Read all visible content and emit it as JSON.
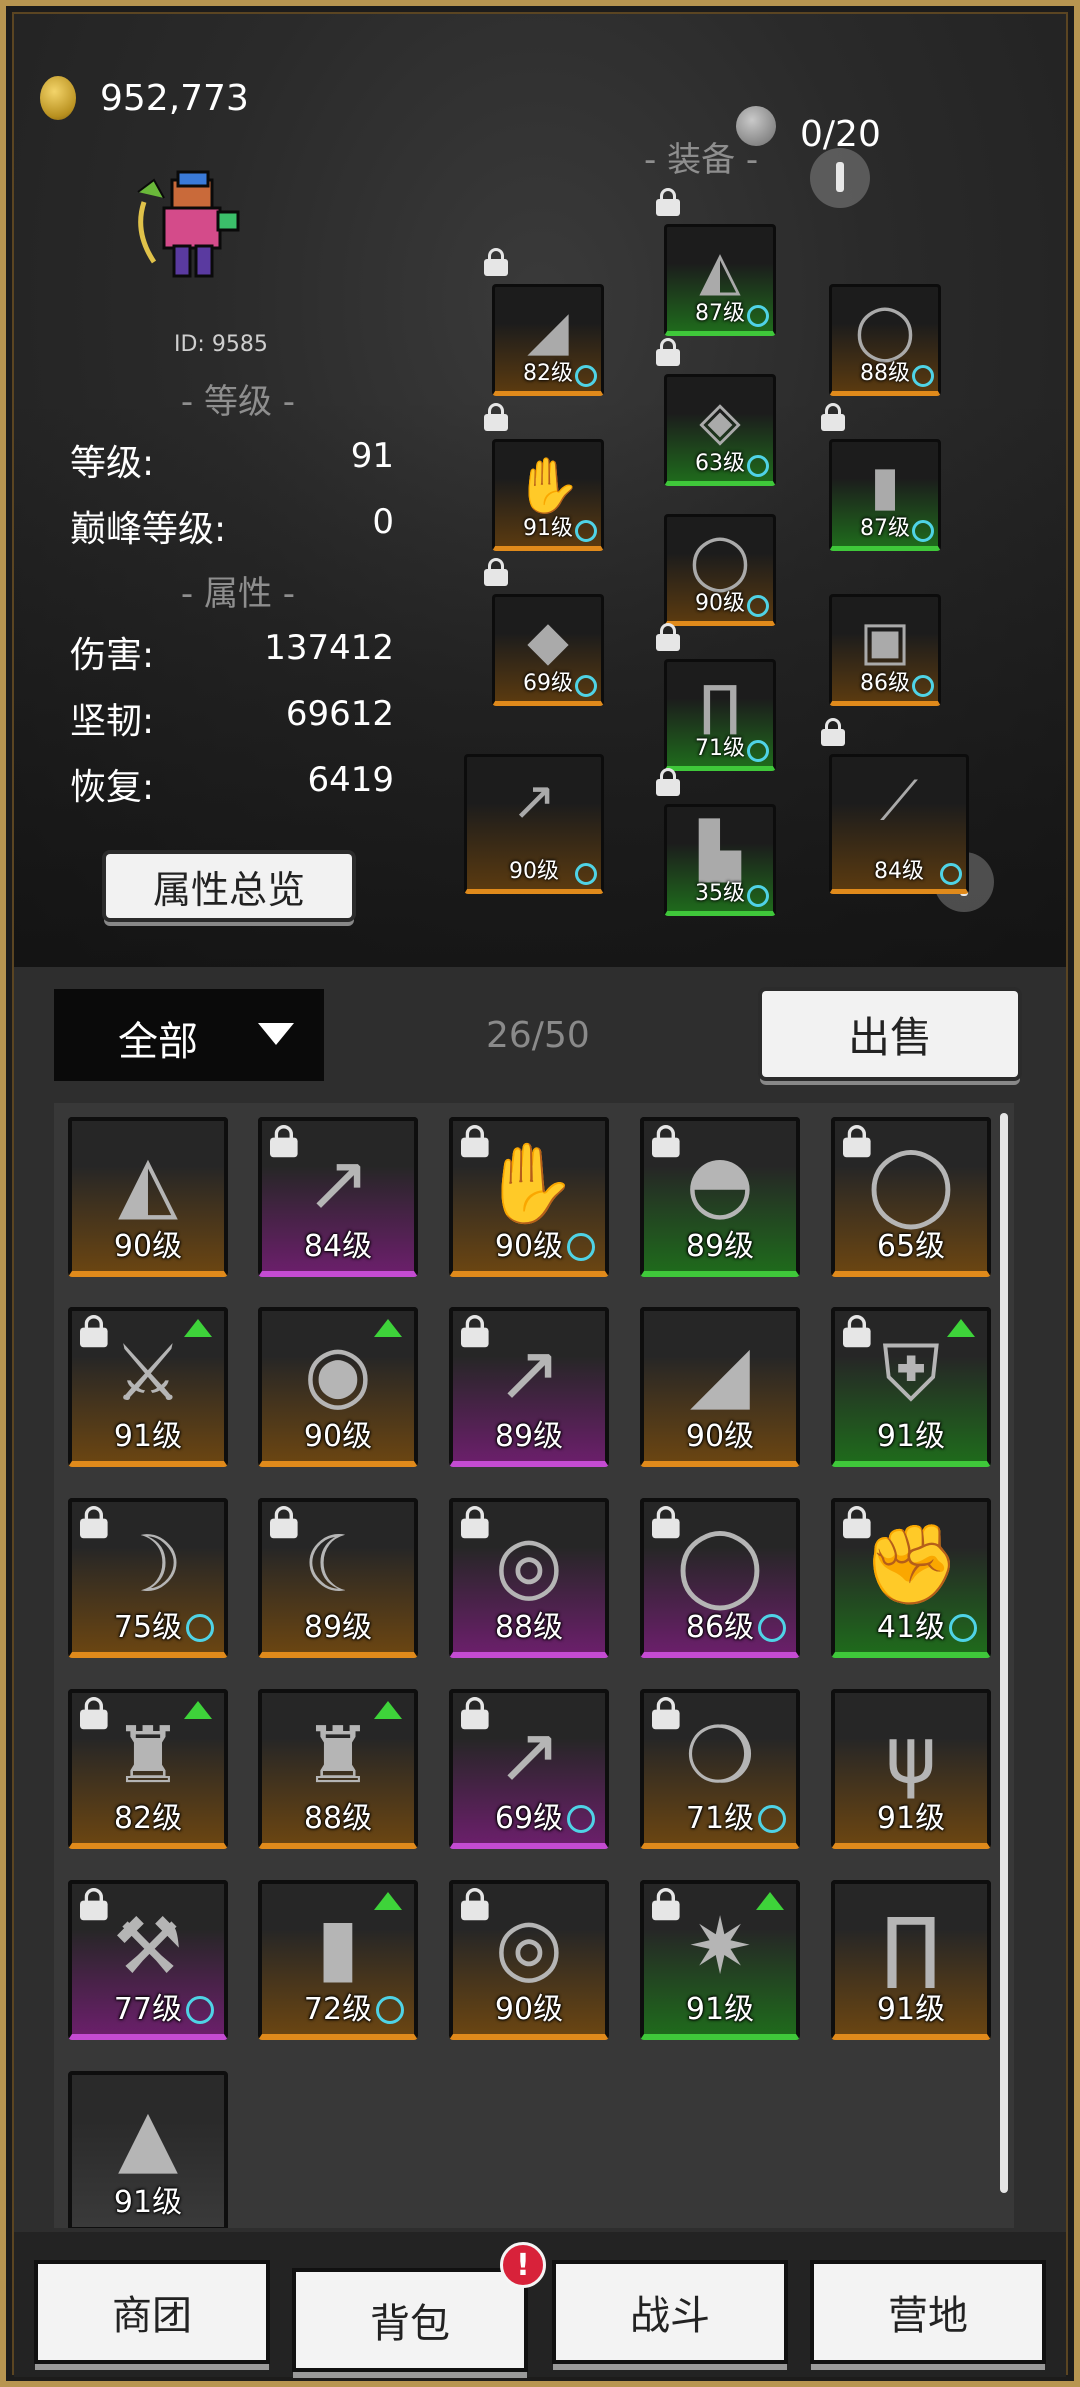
{
  "header": {
    "gold": "952,773",
    "equip_title": "- 装备 -",
    "equip_count": "0/20"
  },
  "profile": {
    "id_text": "ID: 9585"
  },
  "sections": {
    "level_title": "- 等级 -",
    "attr_title": "- 属性 -"
  },
  "stats": {
    "level_label": "等级:",
    "level_value": "91",
    "peak_label": "巅峰等级:",
    "peak_value": "0",
    "damage_label": "伤害:",
    "damage_value": "137412",
    "toughness_label": "坚韧:",
    "toughness_value": "69612",
    "recovery_label": "恢复:",
    "recovery_value": "6419"
  },
  "overview_button": "属性总览",
  "equipment": [
    {
      "level": "82级",
      "rarity": "orange",
      "icon": "cape-icon",
      "locked": true,
      "badge": true
    },
    {
      "level": "87级",
      "rarity": "green",
      "icon": "shoulder-icon",
      "locked": true,
      "badge": true
    },
    {
      "level": "88级",
      "rarity": "orange",
      "icon": "necklace-icon",
      "locked": false,
      "badge": true
    },
    {
      "level": "63级",
      "rarity": "green",
      "icon": "chest-armor-icon",
      "locked": true,
      "badge": true
    },
    {
      "level": "91级",
      "rarity": "orange",
      "icon": "gauntlet-icon",
      "locked": true,
      "badge": true
    },
    {
      "level": "87级",
      "rarity": "green",
      "icon": "bracer-icon",
      "locked": true,
      "badge": true
    },
    {
      "level": "90级",
      "rarity": "orange",
      "icon": "ring-icon",
      "locked": false,
      "badge": true
    },
    {
      "level": "69级",
      "rarity": "orange",
      "icon": "gem-ring-icon",
      "locked": true,
      "badge": true
    },
    {
      "level": "86级",
      "rarity": "orange",
      "icon": "square-ring-icon",
      "locked": false,
      "badge": true
    },
    {
      "level": "71级",
      "rarity": "green",
      "icon": "pants-icon",
      "locked": true,
      "badge": true
    },
    {
      "level": "90级",
      "rarity": "orange",
      "icon": "spear-icon",
      "locked": false,
      "badge": true
    },
    {
      "level": "35级",
      "rarity": "green",
      "icon": "boots-icon",
      "locked": true,
      "badge": true
    },
    {
      "level": "84级",
      "rarity": "orange",
      "icon": "staff-icon",
      "locked": true,
      "badge": true
    }
  ],
  "inventory": {
    "filter_label": "全部",
    "capacity": "26/50",
    "sell_label": "出售",
    "items": [
      {
        "level": "90级",
        "rarity": "orange",
        "icon": "shoulder-icon",
        "locked": false,
        "up": false,
        "badge": false
      },
      {
        "level": "84级",
        "rarity": "purple",
        "icon": "spear-icon",
        "locked": true,
        "up": false,
        "badge": false
      },
      {
        "level": "90级",
        "rarity": "orange",
        "icon": "gauntlet-icon",
        "locked": true,
        "up": false,
        "badge": true
      },
      {
        "level": "89级",
        "rarity": "green",
        "icon": "helmet-icon",
        "locked": true,
        "up": false,
        "badge": false
      },
      {
        "level": "65级",
        "rarity": "orange",
        "icon": "necklace-icon",
        "locked": true,
        "up": false,
        "badge": false
      },
      {
        "level": "91级",
        "rarity": "orange",
        "icon": "sword-icon",
        "locked": true,
        "up": true,
        "badge": false
      },
      {
        "level": "90级",
        "rarity": "orange",
        "icon": "gold-ring-icon",
        "locked": false,
        "up": true,
        "badge": false
      },
      {
        "level": "89级",
        "rarity": "purple",
        "icon": "spear-icon",
        "locked": true,
        "up": false,
        "badge": false
      },
      {
        "level": "90级",
        "rarity": "orange",
        "icon": "cape-icon",
        "locked": false,
        "up": false,
        "badge": false
      },
      {
        "level": "91级",
        "rarity": "green",
        "icon": "shield-icon",
        "locked": true,
        "up": true,
        "badge": false
      },
      {
        "level": "75级",
        "rarity": "orange",
        "icon": "bow-icon",
        "locked": true,
        "up": false,
        "badge": true
      },
      {
        "level": "89级",
        "rarity": "orange",
        "icon": "axe-blade-icon",
        "locked": true,
        "up": false,
        "badge": false
      },
      {
        "level": "88级",
        "rarity": "purple",
        "icon": "bracelet-icon",
        "locked": true,
        "up": false,
        "badge": false
      },
      {
        "level": "86级",
        "rarity": "purple",
        "icon": "ring-icon",
        "locked": true,
        "up": false,
        "badge": true
      },
      {
        "level": "41级",
        "rarity": "green",
        "icon": "gloves-icon",
        "locked": true,
        "up": false,
        "badge": true
      },
      {
        "level": "82级",
        "rarity": "orange",
        "icon": "robe-icon",
        "locked": true,
        "up": true,
        "badge": false
      },
      {
        "level": "88级",
        "rarity": "orange",
        "icon": "robe-icon",
        "locked": false,
        "up": true,
        "badge": false
      },
      {
        "level": "69级",
        "rarity": "purple",
        "icon": "spear-icon",
        "locked": true,
        "up": false,
        "badge": true
      },
      {
        "level": "71级",
        "rarity": "orange",
        "icon": "amulet-icon",
        "locked": true,
        "up": false,
        "badge": true
      },
      {
        "level": "91级",
        "rarity": "orange",
        "icon": "trident-icon",
        "locked": false,
        "up": false,
        "badge": false
      },
      {
        "level": "77级",
        "rarity": "purple",
        "icon": "battle-axe-icon",
        "locked": true,
        "up": false,
        "badge": true
      },
      {
        "level": "72级",
        "rarity": "orange",
        "icon": "bracer-icon",
        "locked": false,
        "up": true,
        "badge": true
      },
      {
        "level": "90级",
        "rarity": "orange",
        "icon": "belt-ring-icon",
        "locked": true,
        "up": false,
        "badge": false
      },
      {
        "level": "91级",
        "rarity": "green",
        "icon": "spiked-shoulder-icon",
        "locked": true,
        "up": true,
        "badge": false
      },
      {
        "level": "91级",
        "rarity": "orange",
        "icon": "pants-icon",
        "locked": false,
        "up": false,
        "badge": false
      },
      {
        "level": "91级",
        "rarity": "gray",
        "icon": "hood-icon",
        "locked": false,
        "up": false,
        "badge": false
      }
    ]
  },
  "nav": {
    "tabs": [
      "商团",
      "背包",
      "战斗",
      "营地"
    ],
    "notification": "!"
  },
  "colors": {
    "orange": "#e08a1b",
    "purple": "#c44bd2",
    "green": "#3fc83a",
    "badge": "#4fd3e6",
    "alert": "#d8223a",
    "frame": "#b89550"
  }
}
